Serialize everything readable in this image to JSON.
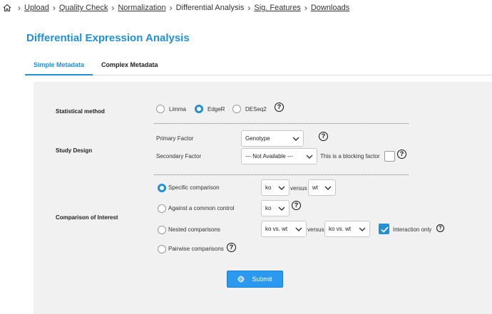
{
  "breadcrumb": {
    "home_icon": "home-icon",
    "items": [
      "Upload",
      "Quality Check",
      "Normalization",
      "Differential Analysis",
      "Sig. Features",
      "Downloads"
    ]
  },
  "page_title": "Differential Expression Analysis",
  "tabs": [
    {
      "label": "Simple Metadata",
      "active": true
    },
    {
      "label": "Complex Metadata",
      "active": false
    }
  ],
  "statistical_method": {
    "label": "Statistical method",
    "options": [
      "Limma",
      "EdgeR",
      "DESeq2"
    ],
    "selected": "EdgeR"
  },
  "study_design": {
    "label": "Study Design",
    "primary_factor_label": "Primary Factor",
    "primary_factor_value": "Genotype",
    "secondary_factor_label": "Secondary Factor",
    "secondary_factor_value": "--- Not Available ---",
    "blocking_factor_label": "This is a blocking factor"
  },
  "comparison": {
    "label": "Comparison of Interest",
    "specific_label": "Specific comparison",
    "specific_a": "ko",
    "versus": "versus",
    "specific_b": "wt",
    "common_control_label": "Against a common control",
    "common_control_value": "ko",
    "nested_label": "Nested comparisons",
    "nested_a": "ko vs. wt",
    "nested_b": "ko vs. wt",
    "interaction_label": "Interaction only",
    "pairwise_label": "Pairwise comparisons",
    "selected": "specific"
  },
  "submit_label": "Submit",
  "colors": {
    "accent": "#2390d6",
    "button": "#2b99f0"
  }
}
